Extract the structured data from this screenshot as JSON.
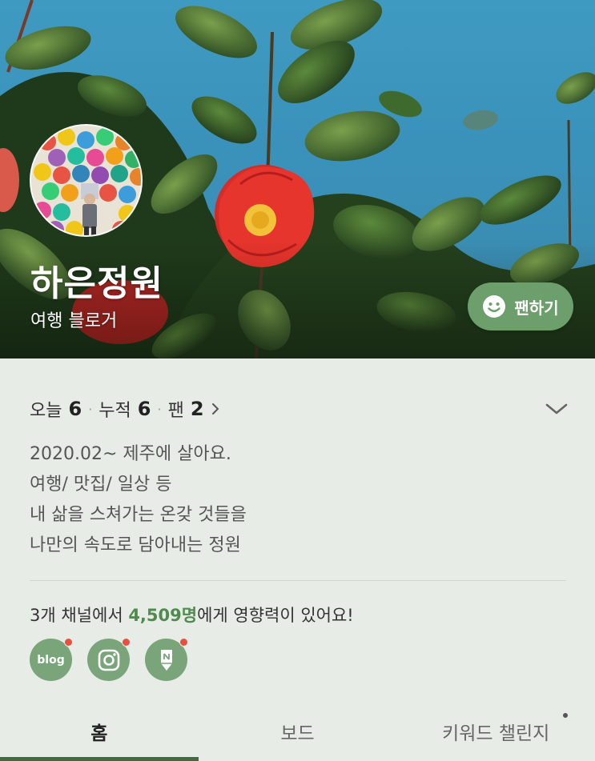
{
  "profile": {
    "title": "하은정원",
    "subtitle": "여행 블로거",
    "fan_button_label": "팬하기"
  },
  "stats": {
    "today_label": "오늘",
    "today_value": "6",
    "total_label": "누적",
    "total_value": "6",
    "fans_label": "팬",
    "fans_value": "2",
    "separator": "·"
  },
  "bio": {
    "lines": [
      "2020.02~ 제주에 살아요.",
      "여행/ 맛집/ 일상 등",
      "내 삶을 스쳐가는 온갖 것들을",
      "나만의 속도로 담아내는 정원"
    ]
  },
  "influence": {
    "prefix": "3개 채널에서 ",
    "count": "4,509명",
    "suffix": "에게 영향력이 있어요!"
  },
  "channels": [
    {
      "name": "blog",
      "label": "blog",
      "icon": "blog-icon"
    },
    {
      "name": "instagram",
      "label": "",
      "icon": "instagram-icon"
    },
    {
      "name": "naver-post",
      "label": "",
      "icon": "naver-post-icon"
    }
  ],
  "tabs": [
    {
      "label": "홈",
      "active": true
    },
    {
      "label": "보드",
      "active": false
    },
    {
      "label": "키워드 챌린지",
      "active": false
    }
  ],
  "colors": {
    "accent": "#6c9f6c",
    "highlight": "#4f8a4f",
    "badge": "#e8503f",
    "background": "#e7ede6"
  }
}
